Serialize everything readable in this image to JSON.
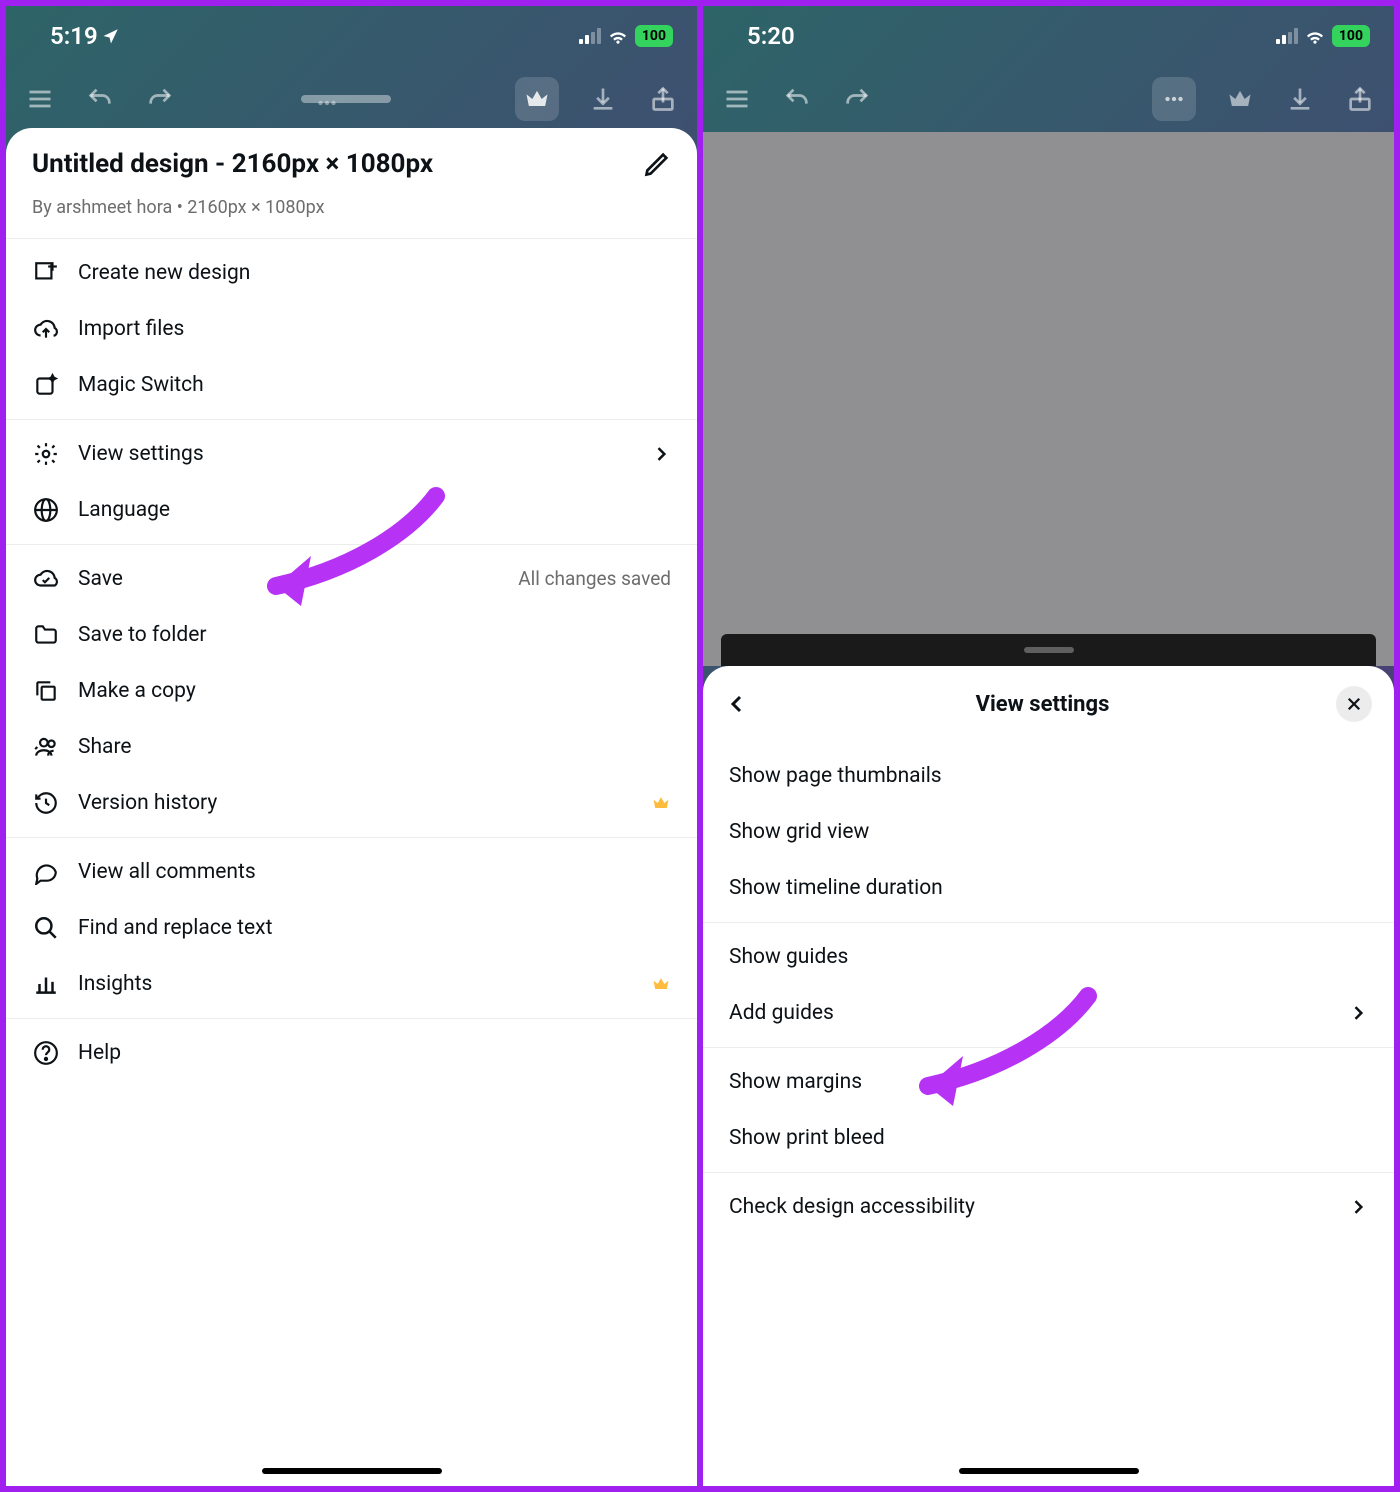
{
  "left": {
    "status": {
      "time": "5:19",
      "battery": "100"
    },
    "sheet": {
      "title": "Untitled design - 2160px × 1080px",
      "subtitle": "By arshmeet hora • 2160px × 1080px"
    },
    "menu": {
      "create": "Create new design",
      "import": "Import files",
      "magic": "Magic Switch",
      "view_settings": "View settings",
      "language": "Language",
      "save": "Save",
      "save_status": "All changes saved",
      "save_folder": "Save to folder",
      "make_copy": "Make a copy",
      "share": "Share",
      "version_history": "Version history",
      "comments": "View all comments",
      "find_replace": "Find and replace text",
      "insights": "Insights",
      "help": "Help"
    }
  },
  "right": {
    "status": {
      "time": "5:20",
      "battery": "100"
    },
    "sheet": {
      "title": "View settings",
      "items": {
        "thumbnails": "Show page thumbnails",
        "grid": "Show grid view",
        "timeline": "Show timeline duration",
        "show_guides": "Show guides",
        "add_guides": "Add guides",
        "margins": "Show margins",
        "bleed": "Show print bleed",
        "accessibility": "Check design accessibility"
      }
    }
  }
}
